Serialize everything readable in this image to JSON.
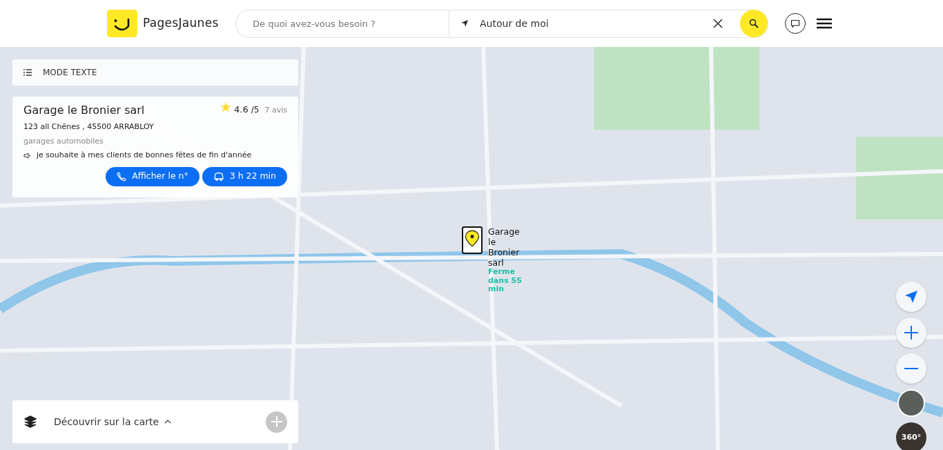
{
  "header": {
    "logo_text": "PagesJaunes",
    "search": {
      "placeholder": "De quoi avez-vous besoin ?"
    },
    "location": {
      "value": "Autour de moi"
    }
  },
  "mode_button": {
    "label": "MODE TEXTE"
  },
  "listing": {
    "name": "Garage le Bronier sarl",
    "rating": "4.6",
    "rating_max": "/5",
    "reviews": "7 avis",
    "address": "123 all Chênes , 45500 ARRABLOY",
    "category": "garages automobiles",
    "message": "je souhaite à mes clients de bonnes fêtes de fin d'année",
    "buttons": [
      {
        "kind": "phone",
        "label": "Afficher le n°"
      },
      {
        "kind": "car",
        "label": "3 h 22 min"
      }
    ]
  },
  "marker": {
    "label": "Garage le Bronier sarl",
    "status": "Ferme dans 55 min"
  },
  "map_controls": [
    {
      "kind": "locate"
    },
    {
      "kind": "zoom_in"
    },
    {
      "kind": "zoom_out"
    },
    {
      "kind": "satellite"
    },
    {
      "kind": "view360",
      "label": "360°"
    }
  ],
  "discover": {
    "label": "Découvrir sur la carte"
  }
}
